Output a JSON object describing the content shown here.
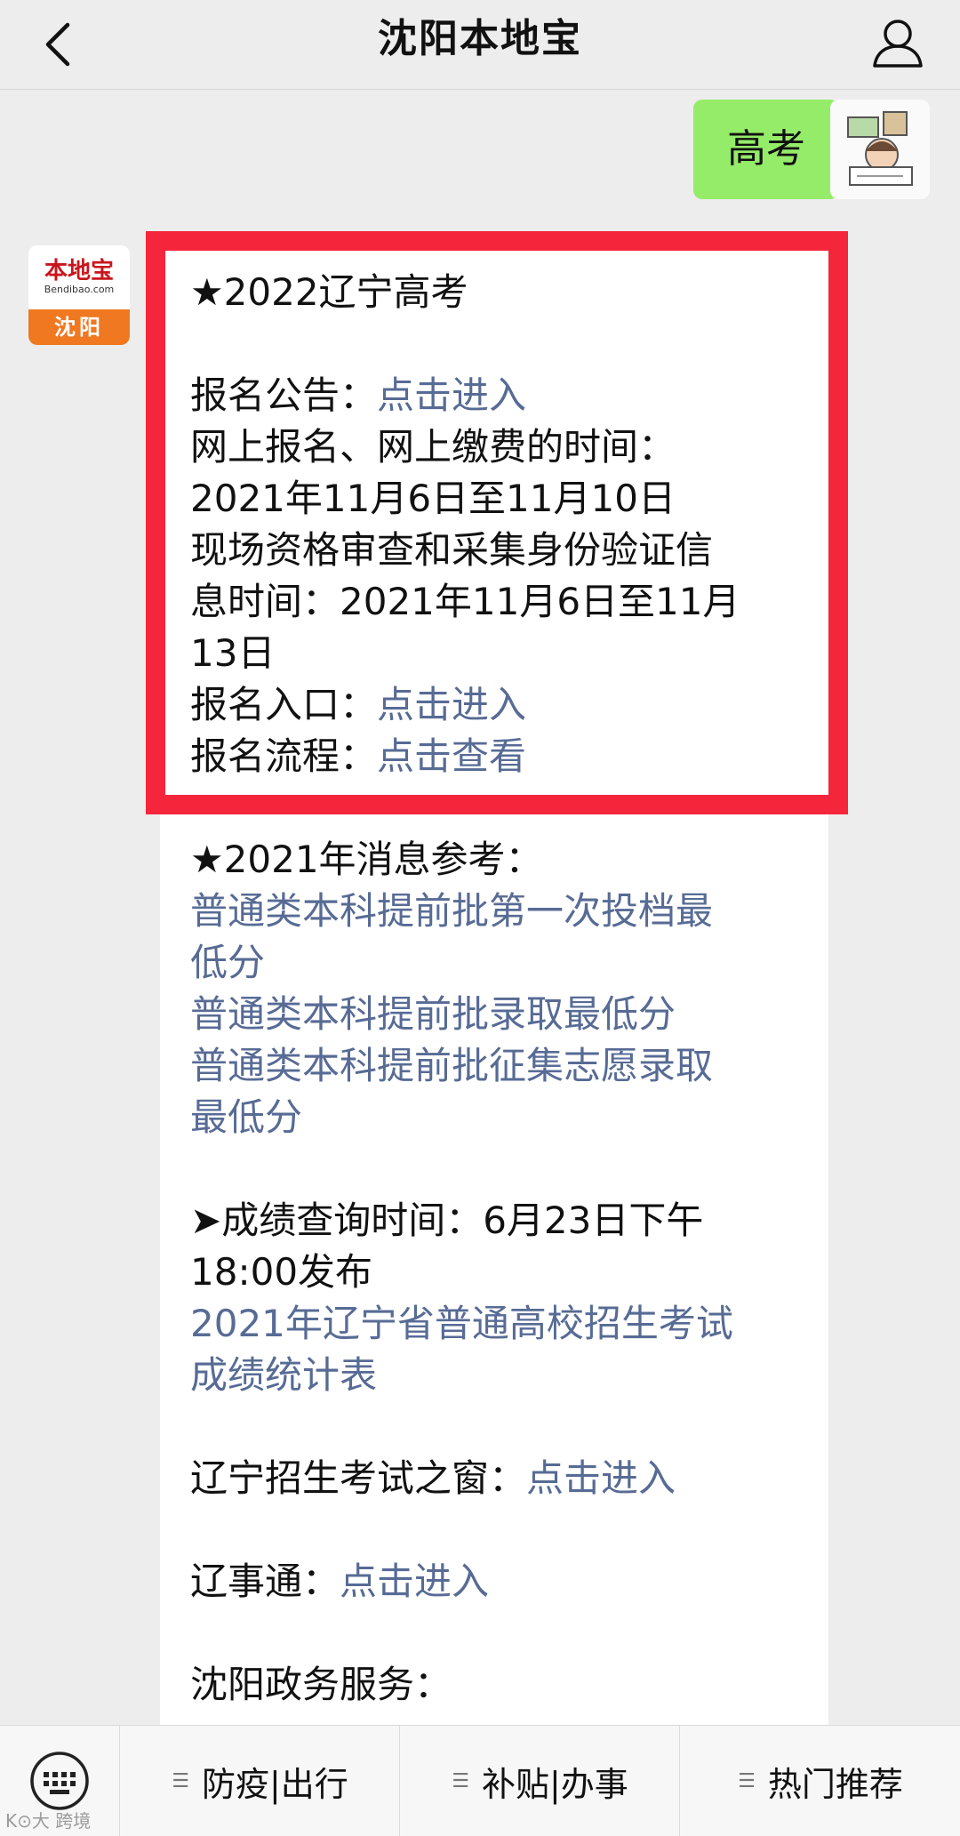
{
  "header": {
    "title": "沈阳本地宝",
    "back_icon": "chevron-left-icon",
    "user_icon": "person-icon"
  },
  "outgoing": {
    "text": "高考"
  },
  "bot_avatar": {
    "brand": "本地宝",
    "url": "Bendibao.com",
    "city": "沈阳"
  },
  "message": {
    "section1_title": "★2022辽宁高考",
    "announce_label": "报名公告：",
    "announce_link": "点击进入",
    "online_time_label": "网上报名、网上缴费的时间：",
    "online_time_value": "2021年11月6日至11月10日",
    "onsite_label_a": "现场资格审查和采集身份验证信",
    "onsite_label_b": "息时间：2021年11月6日至11月",
    "onsite_label_c": "13日",
    "entry_label": "报名入口：",
    "entry_link": "点击进入",
    "process_label": "报名流程：",
    "process_link": "点击查看",
    "section2_title": "★2021年消息参考：",
    "ref_link_1a": "普通类本科提前批第一次投档最",
    "ref_link_1b": "低分",
    "ref_link_2": "普通类本科提前批录取最低分",
    "ref_link_3a": "普通类本科提前批征集志愿录取",
    "ref_link_3b": "最低分",
    "score_time_a": "➤成绩查询时间：6月23日下午",
    "score_time_b": "18:00发布",
    "score_link_a": "2021年辽宁省普通高校招生考试",
    "score_link_b": "成绩统计表",
    "window_label": "辽宁招生考试之窗：",
    "window_link": "点击进入",
    "liaoshi_label": "辽事通：",
    "liaoshi_link": "点击进入",
    "gov_label": "沈阳政务服务："
  },
  "menu": {
    "keyboard_icon": "keyboard-icon",
    "items": [
      {
        "label": "防疫|出行"
      },
      {
        "label": "补贴|办事"
      },
      {
        "label": "热门推荐"
      }
    ]
  },
  "watermark": "K⊙大 跨境"
}
